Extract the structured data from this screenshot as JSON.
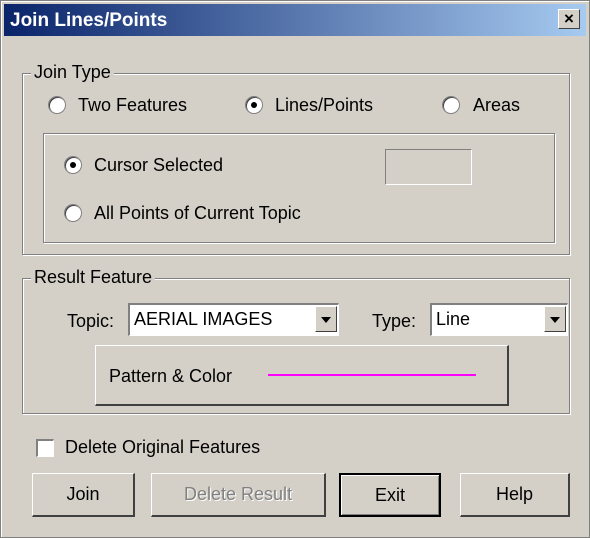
{
  "window": {
    "title": "Join Lines/Points",
    "close_glyph": "×"
  },
  "join_type": {
    "legend": "Join Type",
    "options": [
      {
        "label": "Two Features",
        "selected": false
      },
      {
        "label": "Lines/Points",
        "selected": true
      },
      {
        "label": "Areas",
        "selected": false
      }
    ],
    "selection": {
      "options": [
        {
          "label": "Cursor Selected",
          "selected": true
        },
        {
          "label": "All Points of Current Topic",
          "selected": false
        }
      ],
      "count_value": ""
    }
  },
  "result_feature": {
    "legend": "Result Feature",
    "topic_label": "Topic:",
    "topic_value": "AERIAL IMAGES",
    "type_label": "Type:",
    "type_value": "Line",
    "pattern_button": "Pattern & Color",
    "line_color": "#ff00ff"
  },
  "delete_original": {
    "label": "Delete Original Features",
    "checked": false
  },
  "buttons": {
    "join": "Join",
    "delete_result": "Delete Result",
    "exit": "Exit",
    "help": "Help"
  },
  "colors": {
    "titlebar_start": "#0a246a",
    "titlebar_end": "#a6caf0",
    "face": "#d4d0c8"
  }
}
